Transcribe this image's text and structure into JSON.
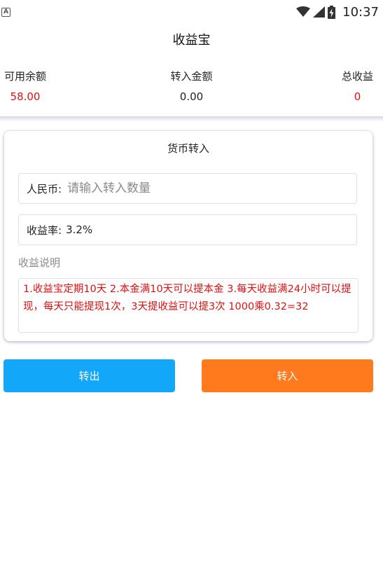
{
  "status_bar": {
    "time": "10:37",
    "icons": [
      "app-icon",
      "wifi-icon",
      "cell-signal-icon",
      "battery-charging-icon"
    ]
  },
  "header": {
    "title": "收益宝"
  },
  "summary": {
    "available": {
      "label": "可用余额",
      "value": "58.00",
      "color": "#e01010"
    },
    "transferred": {
      "label": "转入金额",
      "value": "0.00",
      "color": "#222222"
    },
    "total": {
      "label": "总收益",
      "value": "0",
      "color": "#e01010"
    }
  },
  "card": {
    "title": "货币转入",
    "amount": {
      "label": "人民币:",
      "value": "",
      "placeholder": "请输入转入数量"
    },
    "rate": {
      "label": "收益率:",
      "value": "3.2%"
    },
    "description": {
      "label": "收益说明",
      "text": "1.收益宝定期10天 2.本金满10天可以提本金 3.每天收益满24小时可以提现，每天只能提现1次，3天提收益可以提3次 1000乘0.32=32"
    }
  },
  "actions": {
    "transfer_out": {
      "label": "转出",
      "color": "#13a7fa"
    },
    "transfer_in": {
      "label": "转入",
      "color": "#ff7a1c"
    }
  }
}
